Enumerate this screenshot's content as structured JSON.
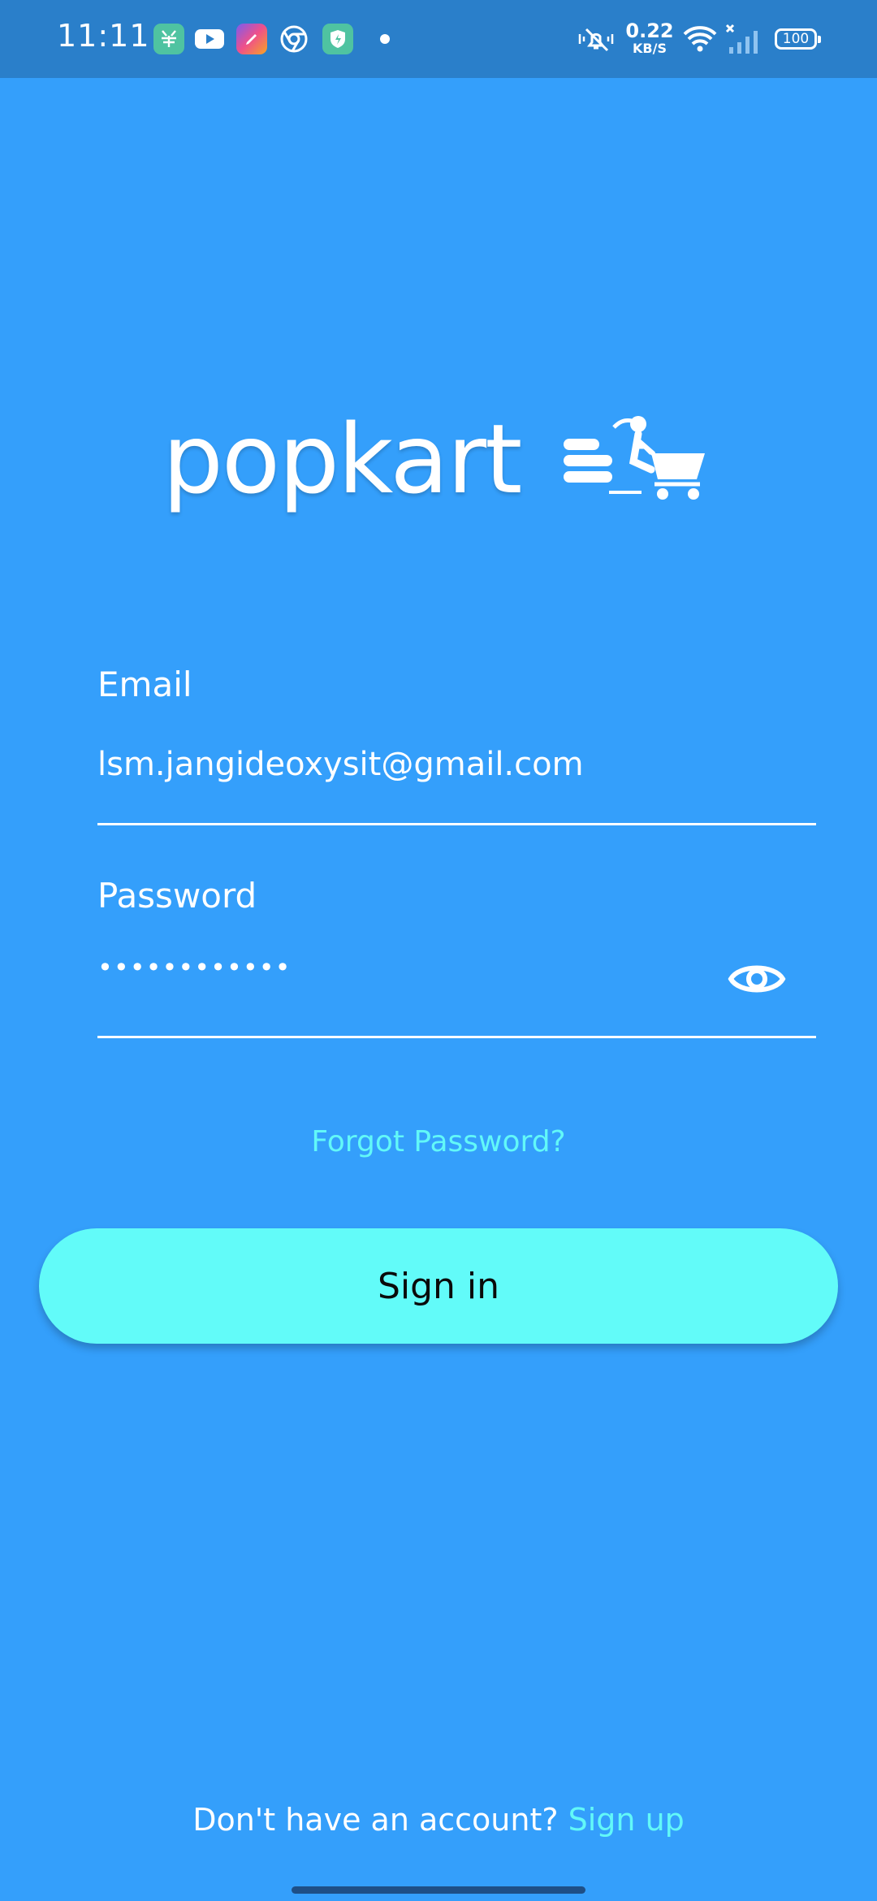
{
  "status_bar": {
    "time": "11:11",
    "app_icons": [
      "chinese-app-icon",
      "youtube-icon",
      "pen-app-icon",
      "chrome-icon",
      "security-shield-icon"
    ],
    "net_speed_value": "0.22",
    "net_speed_unit": "KB/S",
    "battery": "100",
    "icons": [
      "mute-vibrate-icon",
      "wifi-icon",
      "no-signal-icon",
      "battery-icon"
    ]
  },
  "logo": {
    "text": "popkart"
  },
  "form": {
    "email_label": "Email",
    "email_value": "lsm.jangideoxysit@gmail.com",
    "password_label": "Password",
    "password_value": "••••••••••••",
    "eye_icon": "eye-icon"
  },
  "forgot_password": "Forgot Password?",
  "signin_button": "Sign in",
  "footer": {
    "prompt": "Don't have an account? ",
    "signup_link": "Sign up"
  },
  "colors": {
    "background": "#349ffb",
    "status_bar": "#2a7fca",
    "accent": "#62f8f8",
    "button": "#62fbf9"
  }
}
